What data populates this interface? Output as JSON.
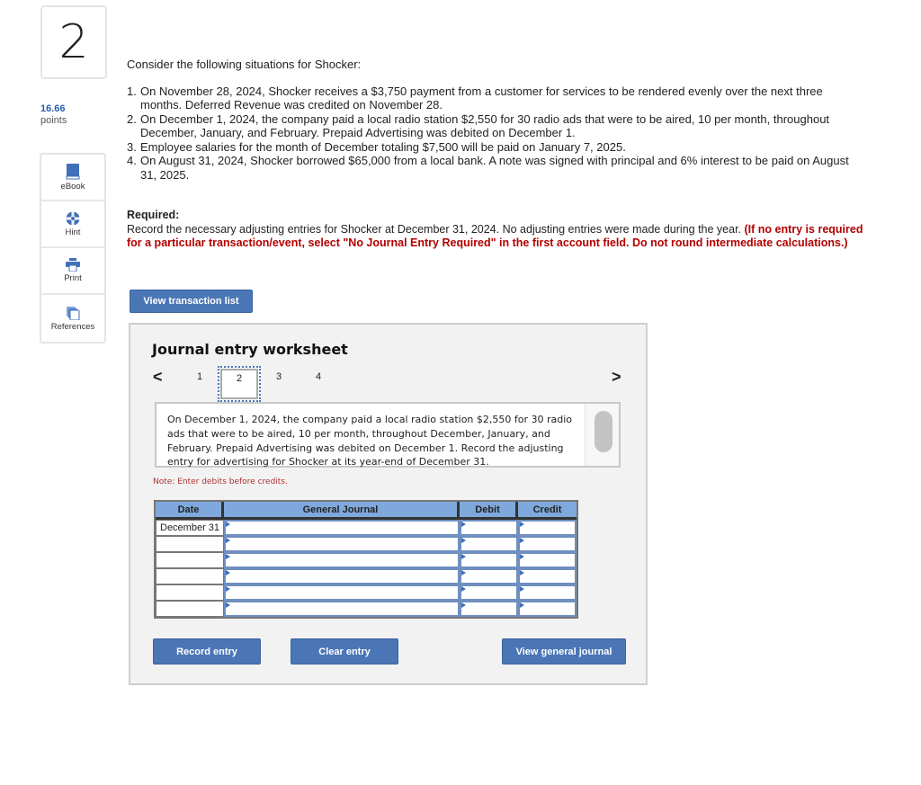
{
  "question": {
    "number": "2",
    "points_value": "16.66",
    "points_label": "points"
  },
  "tools": [
    {
      "label": "eBook",
      "icon": "book-icon"
    },
    {
      "label": "Hint",
      "icon": "lifebuoy-icon"
    },
    {
      "label": "Print",
      "icon": "printer-icon"
    },
    {
      "label": "References",
      "icon": "copy-icon"
    }
  ],
  "intro": "Consider the following situations for Shocker:",
  "situations": [
    {
      "n": "1.",
      "text": "On November 28, 2024, Shocker receives a $3,750 payment from a customer for services to be rendered evenly over the next three months. Deferred Revenue was credited on November 28."
    },
    {
      "n": "2.",
      "text": "On December 1, 2024, the company paid a local radio station $2,550 for 30 radio ads that were to be aired, 10 per month, throughout December, January, and February. Prepaid Advertising was debited on December 1."
    },
    {
      "n": "3.",
      "text": "Employee salaries for the month of December totaling $7,500 will be paid on January 7, 2025."
    },
    {
      "n": "4.",
      "text": "On August 31, 2024, Shocker borrowed $65,000 from a local bank. A note was signed with principal and 6% interest to be paid on August 31, 2025."
    }
  ],
  "required": {
    "heading": "Required:",
    "text": "Record the necessary adjusting entries for Shocker at December 31, 2024. No adjusting entries were made during the year.",
    "instruction": "(If no entry is required for a particular transaction/event, select \"No Journal Entry Required\" in the first account field. Do not round intermediate calculations.)"
  },
  "view_transaction_list": "View transaction list",
  "worksheet": {
    "title": "Journal entry worksheet",
    "prev": "<",
    "next": ">",
    "tabs": [
      "1",
      "2",
      "3",
      "4"
    ],
    "active_tab": "2",
    "description": "On December 1, 2024, the company paid a local radio station $2,550 for 30 radio ads that were to be aired, 10 per month, throughout December, January, and February. Prepaid Advertising was debited on December 1. Record the adjusting entry for advertising for Shocker at its year-end of December 31.",
    "note": "Note: Enter debits before credits.",
    "columns": [
      "Date",
      "General Journal",
      "Debit",
      "Credit"
    ],
    "rows": [
      {
        "date": "December 31",
        "account": "",
        "debit": "",
        "credit": ""
      },
      {
        "date": "",
        "account": "",
        "debit": "",
        "credit": ""
      },
      {
        "date": "",
        "account": "",
        "debit": "",
        "credit": ""
      },
      {
        "date": "",
        "account": "",
        "debit": "",
        "credit": ""
      },
      {
        "date": "",
        "account": "",
        "debit": "",
        "credit": ""
      },
      {
        "date": "",
        "account": "",
        "debit": "",
        "credit": ""
      }
    ],
    "buttons": {
      "record": "Record entry",
      "clear": "Clear entry",
      "view_journal": "View general journal"
    }
  }
}
